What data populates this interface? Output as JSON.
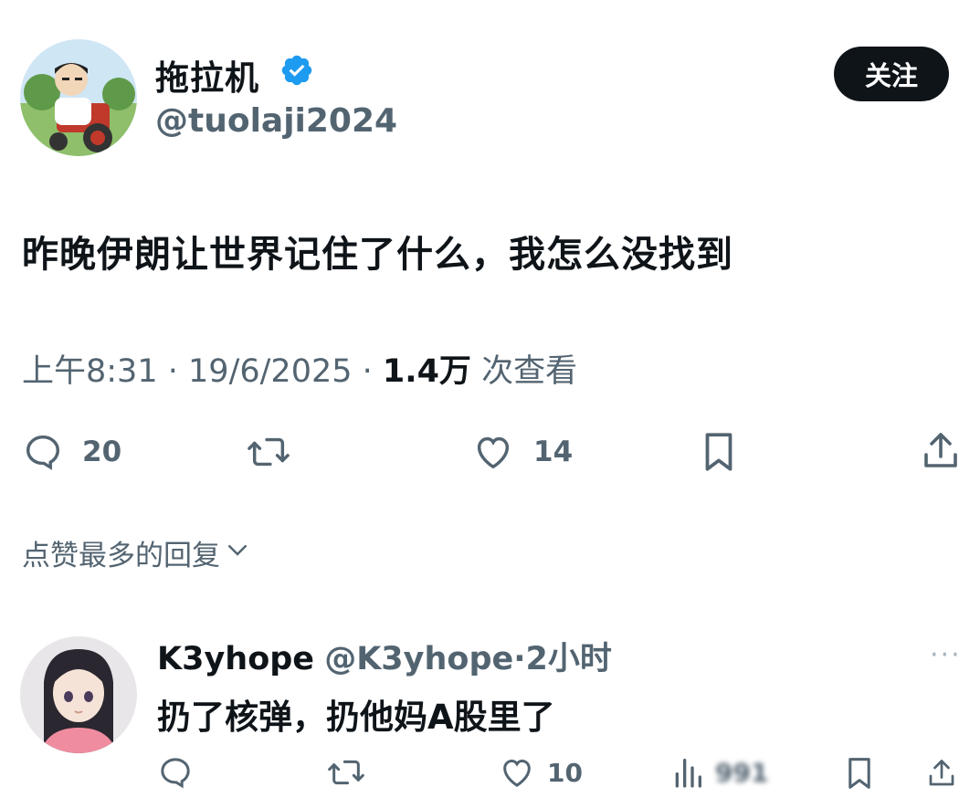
{
  "tweet": {
    "author_name": "拖拉机",
    "author_handle": "@tuolaji2024",
    "follow_label": "关注",
    "text": "昨晚伊朗让世界记住了什么，我怎么没找到",
    "time": "上午8:31",
    "date": "19/6/2025",
    "views_count": "1.4万",
    "views_label": "次查看",
    "sep": "·",
    "replies": "20",
    "likes": "14"
  },
  "replies_section": {
    "sort_label": "点赞最多的回复"
  },
  "reply": {
    "name": "K3yhope",
    "handle": "@K3yhope",
    "sep": "·",
    "time": "2小时",
    "more": "···",
    "text": "扔了核弹，扔他妈A股里了",
    "likes": "10",
    "views": "991"
  },
  "icons": [
    "verified-badge-icon",
    "reply-icon",
    "retweet-icon",
    "like-icon",
    "bookmark-icon",
    "share-icon",
    "chevron-down-icon",
    "views-icon",
    "more-icon"
  ],
  "colors": {
    "accent": "#1d9bf0",
    "text": "#0f1419",
    "secondary": "#536471",
    "button": "#0f1419"
  }
}
